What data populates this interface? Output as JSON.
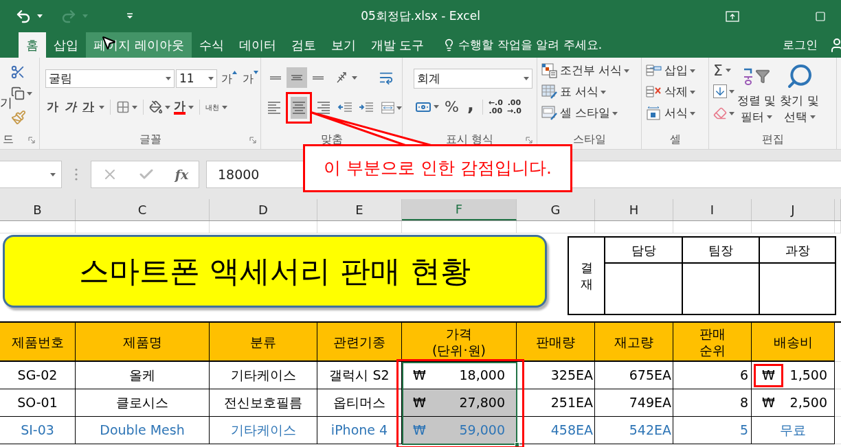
{
  "title_bar": {
    "title": "05회정답.xlsx - Excel",
    "redo_disabled": true
  },
  "tabs": [
    {
      "label": "홈",
      "selected": true,
      "hovered": false
    },
    {
      "label": "삽입",
      "selected": false,
      "hovered": false
    },
    {
      "label": "페이지 레이아웃",
      "selected": false,
      "hovered": true
    },
    {
      "label": "수식",
      "selected": false,
      "hovered": false
    },
    {
      "label": "데이터",
      "selected": false,
      "hovered": false
    },
    {
      "label": "검토",
      "selected": false,
      "hovered": false
    },
    {
      "label": "보기",
      "selected": false,
      "hovered": false
    },
    {
      "label": "개발 도구",
      "selected": false,
      "hovered": false
    }
  ],
  "tell_me": "수행할 작업을 알려 주세요.",
  "sign_in": "로그인",
  "ribbon": {
    "clipboard": {
      "paste_label": "기",
      "group_label": "드"
    },
    "font": {
      "name": "굴림",
      "size": "11",
      "grow": "가",
      "shrink": "가",
      "bold": "가",
      "italic": "가",
      "underline": "가",
      "font_color": "가",
      "phonetic": "내천",
      "group_label": "글꼴"
    },
    "alignment": {
      "vertical": [
        {
          "kind": "top",
          "selected": false
        },
        {
          "kind": "middle",
          "selected": true
        },
        {
          "kind": "bottom",
          "selected": false
        }
      ],
      "horizontal": [
        {
          "kind": "left",
          "selected": false,
          "marked": false
        },
        {
          "kind": "center",
          "selected": true,
          "marked": true
        },
        {
          "kind": "right",
          "selected": false,
          "marked": false
        }
      ],
      "group_label": "맞춤"
    },
    "number": {
      "format": "회계",
      "percent": "%",
      "comma": ",",
      "decimal_increase": [
        "←.0",
        ".00"
      ],
      "decimal_decrease": [
        ".00",
        "→.0"
      ],
      "group_label": "표시 형식"
    },
    "styles": {
      "items": [
        {
          "kind": "conditional",
          "label": "조건부 서식"
        },
        {
          "kind": "table",
          "label": "표 서식"
        },
        {
          "kind": "cell",
          "label": "셀 스타일"
        }
      ],
      "group_label": "스타일"
    },
    "cells": {
      "items": [
        {
          "kind": "insert",
          "label": "삽입"
        },
        {
          "kind": "delete",
          "label": "삭제"
        },
        {
          "kind": "format",
          "label": "서식"
        }
      ],
      "group_label": "셀"
    },
    "editing": {
      "sum": "Σ",
      "sort": [
        "정렬 및",
        "필터"
      ],
      "find": [
        "찾기 및",
        "선택"
      ],
      "group_label": "편집"
    }
  },
  "formula_bar": {
    "fx": "fx",
    "value": "18000"
  },
  "columns": [
    {
      "label": "B",
      "selected": false
    },
    {
      "label": "C",
      "selected": false
    },
    {
      "label": "D",
      "selected": false
    },
    {
      "label": "E",
      "selected": false
    },
    {
      "label": "F",
      "selected": true
    },
    {
      "label": "G",
      "selected": false
    },
    {
      "label": "H",
      "selected": false
    },
    {
      "label": "I",
      "selected": false
    },
    {
      "label": "J",
      "selected": false
    }
  ],
  "title_shape": {
    "text": "스마트폰 액세서리 판매 현황"
  },
  "approval": {
    "side_label": "결재",
    "roles": [
      "담당",
      "팀장",
      "과장"
    ]
  },
  "table": {
    "headers": [
      "제품번호",
      "제품명",
      "분류",
      "관련기종",
      "가격\n(단위·원)",
      "판매량",
      "재고량",
      "판매\n순위",
      "배송비"
    ],
    "price_column_marked": true,
    "rows": [
      {
        "color": "#000000",
        "cells": [
          "SG-02",
          "올케",
          "기타케이스",
          "갤럭시 S2"
        ],
        "price": {
          "symbol": "₩",
          "amount": "18,000",
          "selected": true,
          "active": true
        },
        "sales": "325EA",
        "stock": "675EA",
        "rank": "6",
        "shipping": {
          "kind": "currency",
          "symbol": "₩",
          "amount": "1,500",
          "marked": true
        }
      },
      {
        "color": "#000000",
        "cells": [
          "SO-01",
          "클로시스",
          "전신보호필름",
          "옵티머스"
        ],
        "price": {
          "symbol": "₩",
          "amount": "27,800",
          "selected": true,
          "active": false
        },
        "sales": "251EA",
        "stock": "749EA",
        "rank": "8",
        "shipping": {
          "kind": "currency",
          "symbol": "₩",
          "amount": "2,500",
          "marked": false
        }
      },
      {
        "color": "#2e75b6",
        "cells": [
          "SI-03",
          "Double Mesh",
          "기타케이스",
          "iPhone 4"
        ],
        "price": {
          "symbol": "₩",
          "amount": "59,000",
          "selected": true,
          "active": false
        },
        "sales": "458EA",
        "stock": "542EA",
        "rank": "5",
        "shipping": {
          "kind": "text",
          "text": "무료"
        }
      }
    ]
  },
  "callout": {
    "text": "이 부분으로 인한 감점입니다."
  }
}
